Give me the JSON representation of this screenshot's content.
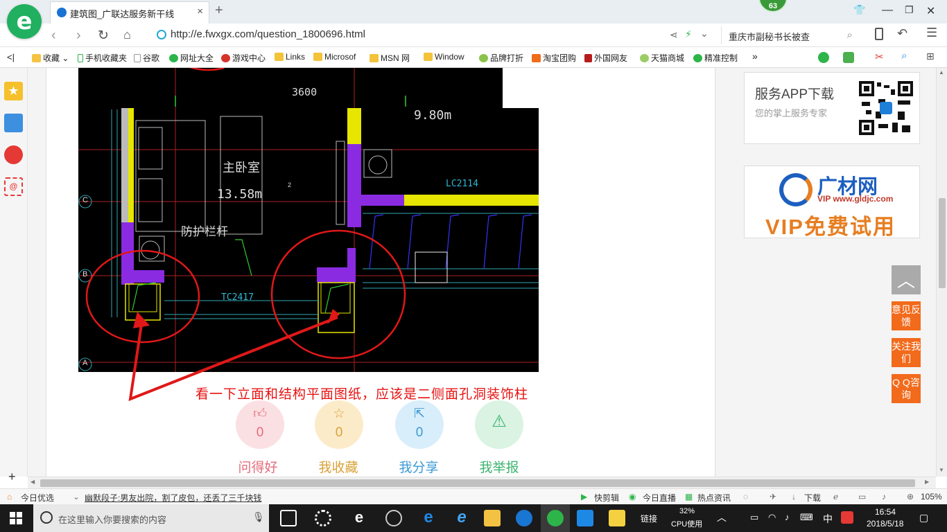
{
  "browser": {
    "tab_title": "建筑图_广联达服务新干线",
    "tab_close": "×",
    "new_tab": "+",
    "badge_count": "63",
    "address_url": "http://e.fwxgx.com/question_1800696.html",
    "search_text": "重庆市副秘书长被查",
    "bookmarks": [
      "收藏",
      "手机收藏夹",
      "谷歌",
      "网址大全",
      "游戏中心",
      "Links",
      "Microsof",
      "MSN 网",
      "Window",
      "品牌打折",
      "淘宝团购",
      "外国网友",
      "天猫商城",
      "精准控制"
    ],
    "bookmarks_more": "»",
    "back_toggle": "<|"
  },
  "cad": {
    "dim_top": "3600",
    "area_right": "9.80m",
    "room_name": "主卧室",
    "room_area": "13.58m",
    "small_mark": "2",
    "window_code_1": "LC2114",
    "railing_label": "防护栏杆",
    "window_code_2": "TC2417",
    "axis_c": "C",
    "axis_b": "B",
    "axis_a": "A"
  },
  "caption": "看一下立面和结构平面图纸，应该是二侧面孔洞装饰柱",
  "actions": [
    {
      "label": "问得好",
      "count": "0",
      "color": "#e36c7a",
      "bg": "#fbe0e3"
    },
    {
      "label": "我收藏",
      "count": "0",
      "color": "#d9a238",
      "bg": "#fcebc9"
    },
    {
      "label": "我分享",
      "count": "0",
      "color": "#3c9ad6",
      "bg": "#d9eefb"
    },
    {
      "label": "我举报",
      "count": "",
      "color": "#3cb46e",
      "bg": "#daf3e3"
    }
  ],
  "sidebar_right": {
    "app_title": "服务APP下载",
    "app_desc": "您的掌上服务专家",
    "ad_name": "广材网",
    "ad_url": "VIP www.gldjc.com",
    "ad_vip": "VIP免费试用",
    "feedback": "意见反馈",
    "follow": "关注我们",
    "qq": "Q Q咨询"
  },
  "statusbar": {
    "today_pick": "今日优选",
    "news": "幽默段子:男友出院，割了皮包，还丢了三千块钱",
    "quick_clip": "快剪辑",
    "live": "今日直播",
    "hot_news": "热点资讯",
    "download": "下载",
    "zoom": "105%"
  },
  "taskbar": {
    "search_placeholder": "在这里输入你要搜索的内容",
    "link": "链接",
    "cpu_pct": "32%",
    "cpu_label": "CPU使用",
    "ime": "中",
    "time": "16:54",
    "date": "2018/5/18"
  }
}
